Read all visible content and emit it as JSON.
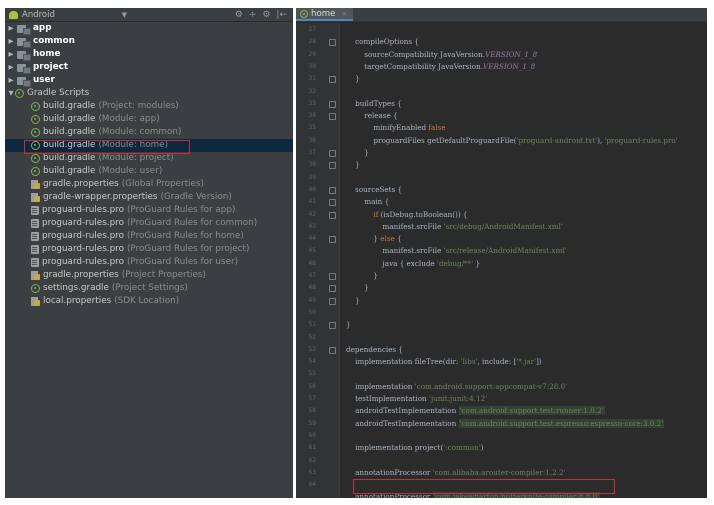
{
  "project_panel": {
    "view_selector": "Android",
    "header_tools": [
      "⚙",
      "÷",
      "⚙",
      "|←"
    ],
    "tree": [
      {
        "label": "app",
        "detail": "",
        "type": "folder",
        "indent": 0,
        "arrow": "▶"
      },
      {
        "label": "common",
        "detail": "",
        "type": "folder",
        "indent": 0,
        "arrow": "▶"
      },
      {
        "label": "home",
        "detail": "",
        "type": "folder",
        "indent": 0,
        "arrow": "▶"
      },
      {
        "label": "project",
        "detail": "",
        "type": "folder",
        "indent": 0,
        "arrow": "▶"
      },
      {
        "label": "user",
        "detail": "",
        "type": "folder",
        "indent": 0,
        "arrow": "▶"
      },
      {
        "label": "Gradle Scripts",
        "detail": "",
        "type": "gradle-root",
        "indent": 0,
        "arrow": "▼"
      },
      {
        "label": "build.gradle",
        "detail": "(Project: modules)",
        "type": "gradle",
        "indent": 1
      },
      {
        "label": "build.gradle",
        "detail": "(Module: app)",
        "type": "gradle",
        "indent": 1
      },
      {
        "label": "build.gradle",
        "detail": "(Module: common)",
        "type": "gradle",
        "indent": 1
      },
      {
        "label": "build.gradle",
        "detail": "(Module: home)",
        "type": "gradle",
        "indent": 1,
        "selected": true
      },
      {
        "label": "build.gradle",
        "detail": "(Module: project)",
        "type": "gradle",
        "indent": 1
      },
      {
        "label": "build.gradle",
        "detail": "(Module: user)",
        "type": "gradle",
        "indent": 1
      },
      {
        "label": "gradle.properties",
        "detail": "(Global Properties)",
        "type": "props",
        "indent": 1
      },
      {
        "label": "gradle-wrapper.properties",
        "detail": "(Gradle Version)",
        "type": "props",
        "indent": 1
      },
      {
        "label": "proguard-rules.pro",
        "detail": "(ProGuard Rules for app)",
        "type": "file",
        "indent": 1
      },
      {
        "label": "proguard-rules.pro",
        "detail": "(ProGuard Rules for common)",
        "type": "file",
        "indent": 1
      },
      {
        "label": "proguard-rules.pro",
        "detail": "(ProGuard Rules for home)",
        "type": "file",
        "indent": 1
      },
      {
        "label": "proguard-rules.pro",
        "detail": "(ProGuard Rules for project)",
        "type": "file",
        "indent": 1
      },
      {
        "label": "proguard-rules.pro",
        "detail": "(ProGuard Rules for user)",
        "type": "file",
        "indent": 1
      },
      {
        "label": "gradle.properties",
        "detail": "(Project Properties)",
        "type": "props",
        "indent": 1
      },
      {
        "label": "settings.gradle",
        "detail": "(Project Settings)",
        "type": "gradle",
        "indent": 1
      },
      {
        "label": "local.properties",
        "detail": "(SDK Location)",
        "type": "props",
        "indent": 1
      }
    ]
  },
  "editor": {
    "tab_label": "home",
    "tab_close": "×",
    "line_numbers": [
      "27",
      "28",
      "29",
      "30",
      "31",
      "32",
      "33",
      "34",
      "35",
      "36",
      "37",
      "38",
      "39",
      "40",
      "41",
      "42",
      "43",
      "44",
      "45",
      "46",
      "47",
      "48",
      "49",
      "50",
      "51",
      "52",
      "53",
      "54",
      "55",
      "56",
      "57",
      "58",
      "59",
      "60",
      "61",
      "62",
      "63",
      "64"
    ],
    "code": [
      [
        {
          "t": ""
        }
      ],
      [
        {
          "t": "    compileOptions {"
        }
      ],
      [
        {
          "t": "        sourceCompatibility JavaVersion."
        },
        {
          "t": "VERSION_1_8",
          "c": "ital"
        }
      ],
      [
        {
          "t": "        targetCompatibility JavaVersion."
        },
        {
          "t": "VERSION_1_8",
          "c": "ital"
        }
      ],
      [
        {
          "t": "    }"
        }
      ],
      [
        {
          "t": ""
        }
      ],
      [
        {
          "t": "    buildTypes {"
        }
      ],
      [
        {
          "t": "        release {"
        }
      ],
      [
        {
          "t": "            minifyEnabled "
        },
        {
          "t": "false",
          "c": "kw"
        }
      ],
      [
        {
          "t": "            proguardFiles getDefaultProguardFile("
        },
        {
          "t": "'proguard-android.txt'",
          "c": "str"
        },
        {
          "t": "), "
        },
        {
          "t": "'proguard-rules.pro'",
          "c": "str"
        }
      ],
      [
        {
          "t": "        }"
        }
      ],
      [
        {
          "t": "    }"
        }
      ],
      [
        {
          "t": ""
        }
      ],
      [
        {
          "t": "    sourceSets {"
        }
      ],
      [
        {
          "t": "        main {"
        }
      ],
      [
        {
          "t": "            "
        },
        {
          "t": "if",
          "c": "kw"
        },
        {
          "t": " (isDebug.toBoolean()) {"
        }
      ],
      [
        {
          "t": "                manifest.srcFile "
        },
        {
          "t": "'src/debug/AndroidManifest.xml'",
          "c": "str"
        }
      ],
      [
        {
          "t": "            } "
        },
        {
          "t": "else",
          "c": "kw"
        },
        {
          "t": " {"
        }
      ],
      [
        {
          "t": "                manifest.srcFile "
        },
        {
          "t": "'src/release/AndroidManifest.xml'",
          "c": "str"
        }
      ],
      [
        {
          "t": "                java { exclude "
        },
        {
          "t": "'debug/**'",
          "c": "str"
        },
        {
          "t": " }"
        }
      ],
      [
        {
          "t": "            }"
        }
      ],
      [
        {
          "t": "        }"
        }
      ],
      [
        {
          "t": "    }"
        }
      ],
      [
        {
          "t": ""
        }
      ],
      [
        {
          "t": "}"
        }
      ],
      [
        {
          "t": ""
        }
      ],
      [
        {
          "t": "dependencies {"
        }
      ],
      [
        {
          "t": "    implementation fileTree(dir: "
        },
        {
          "t": "'libs'",
          "c": "str"
        },
        {
          "t": ", include: ["
        },
        {
          "t": "'*.jar'",
          "c": "str"
        },
        {
          "t": "])"
        }
      ],
      [
        {
          "t": ""
        }
      ],
      [
        {
          "t": "    implementation "
        },
        {
          "t": "'com.android.support:appcompat-v7:28.0'",
          "c": "str"
        }
      ],
      [
        {
          "t": "    testImplementation "
        },
        {
          "t": "'junit:junit:4.12'",
          "c": "str"
        }
      ],
      [
        {
          "t": "    androidTestImplementation "
        },
        {
          "t": "'com.android.support.test:runner:1.0.2'",
          "c": "hl"
        }
      ],
      [
        {
          "t": "    androidTestImplementation "
        },
        {
          "t": "'com.android.support.test.espresso:espresso-core:3.0.2'",
          "c": "hl"
        }
      ],
      [
        {
          "t": ""
        }
      ],
      [
        {
          "t": "    implementation project("
        },
        {
          "t": "':common'",
          "c": "str"
        },
        {
          "t": ")"
        }
      ],
      [
        {
          "t": ""
        }
      ],
      [
        {
          "t": "    annotationProcessor "
        },
        {
          "t": "'com.alibaba:arouter-compiler:1.2.2'",
          "c": "str"
        }
      ],
      [
        {
          "t": ""
        }
      ],
      [
        {
          "t": "    annotationProcessor "
        },
        {
          "t": "'com.jakewharton:butterknife-compiler:8.8.0'",
          "c": "hl"
        }
      ],
      [
        {
          "t": "}"
        }
      ]
    ]
  }
}
